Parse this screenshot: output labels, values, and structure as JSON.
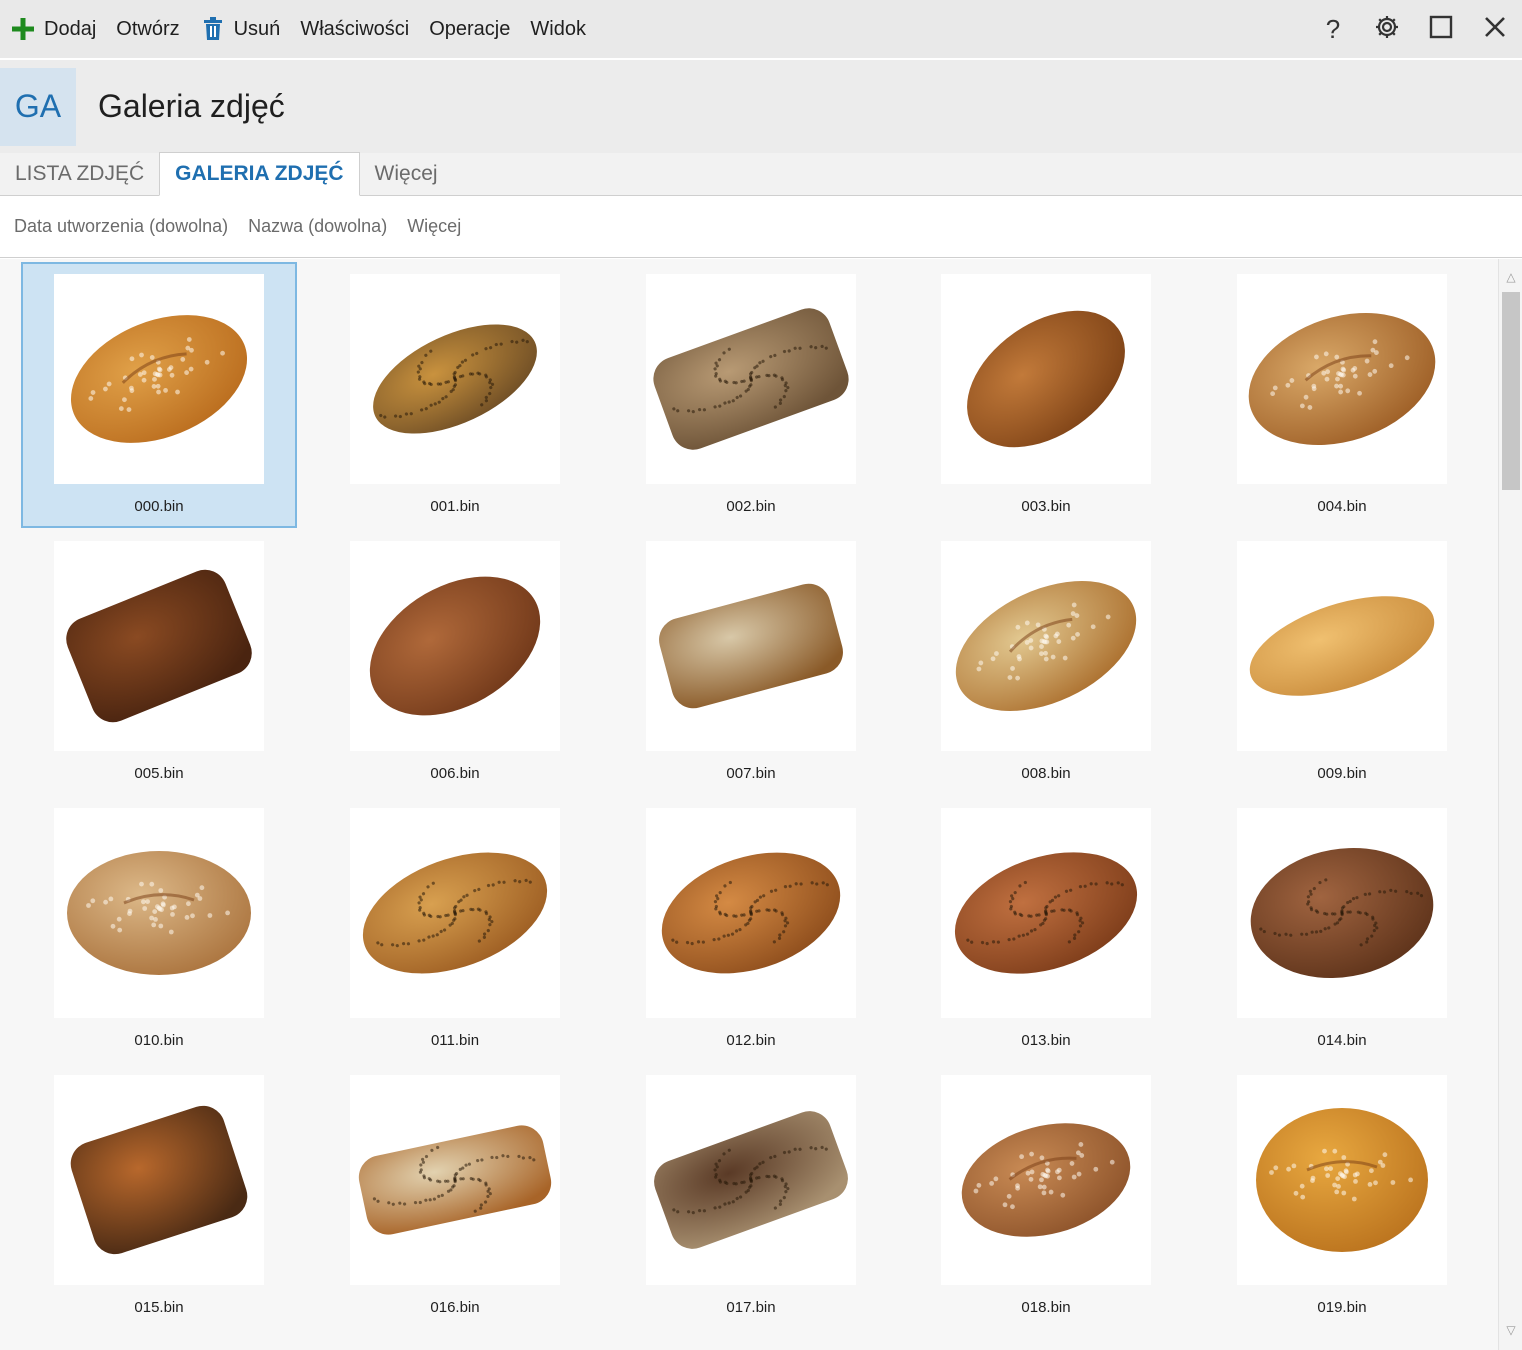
{
  "toolbar": {
    "add_label": "Dodaj",
    "open_label": "Otwórz",
    "delete_label": "Usuń",
    "properties_label": "Właściwości",
    "operations_label": "Operacje",
    "view_label": "Widok",
    "help_label": "?"
  },
  "header": {
    "badge": "GA",
    "title": "Galeria zdjęć"
  },
  "tabs": [
    {
      "label": "LISTA ZDJĘĆ",
      "active": false
    },
    {
      "label": "GALERIA ZDJĘĆ",
      "active": true
    },
    {
      "label": "Więcej",
      "active": false
    }
  ],
  "filters": [
    {
      "label": "Data utworzenia (dowolna)"
    },
    {
      "label": "Nazwa (dowolna)"
    },
    {
      "label": "Więcej"
    }
  ],
  "colors": {
    "accent": "#1f6fb0",
    "add_icon": "#1e8a1e",
    "delete_icon": "#1f6fb0",
    "selected_bg": "#cde3f3",
    "selected_border": "#7db8e2"
  },
  "gallery": {
    "items": [
      {
        "name": "000.bin",
        "selected": true,
        "bread": "oval-golden"
      },
      {
        "name": "001.bin",
        "selected": false,
        "bread": "poppy-baguette"
      },
      {
        "name": "002.bin",
        "selected": false,
        "bread": "grain-loaf"
      },
      {
        "name": "003.bin",
        "selected": false,
        "bread": "oval-brown"
      },
      {
        "name": "004.bin",
        "selected": false,
        "bread": "rustic-floured"
      },
      {
        "name": "005.bin",
        "selected": false,
        "bread": "dark-tin-loaf"
      },
      {
        "name": "006.bin",
        "selected": false,
        "bread": "brown-oval"
      },
      {
        "name": "007.bin",
        "selected": false,
        "bread": "cut-loaf"
      },
      {
        "name": "008.bin",
        "selected": false,
        "bread": "cut-rustic"
      },
      {
        "name": "009.bin",
        "selected": false,
        "bread": "pale-baguette"
      },
      {
        "name": "010.bin",
        "selected": false,
        "bread": "round-floured"
      },
      {
        "name": "011.bin",
        "selected": false,
        "bread": "cut-seeded"
      },
      {
        "name": "012.bin",
        "selected": false,
        "bread": "oval-seeded"
      },
      {
        "name": "013.bin",
        "selected": false,
        "bread": "oval-dark-seeded"
      },
      {
        "name": "014.bin",
        "selected": false,
        "bread": "dark-round"
      },
      {
        "name": "015.bin",
        "selected": false,
        "bread": "tall-tin-loaf"
      },
      {
        "name": "016.bin",
        "selected": false,
        "bread": "cut-flat"
      },
      {
        "name": "017.bin",
        "selected": false,
        "bread": "grain-rye"
      },
      {
        "name": "018.bin",
        "selected": false,
        "bread": "oval-floured"
      },
      {
        "name": "019.bin",
        "selected": false,
        "bread": "round-glazed"
      }
    ]
  }
}
